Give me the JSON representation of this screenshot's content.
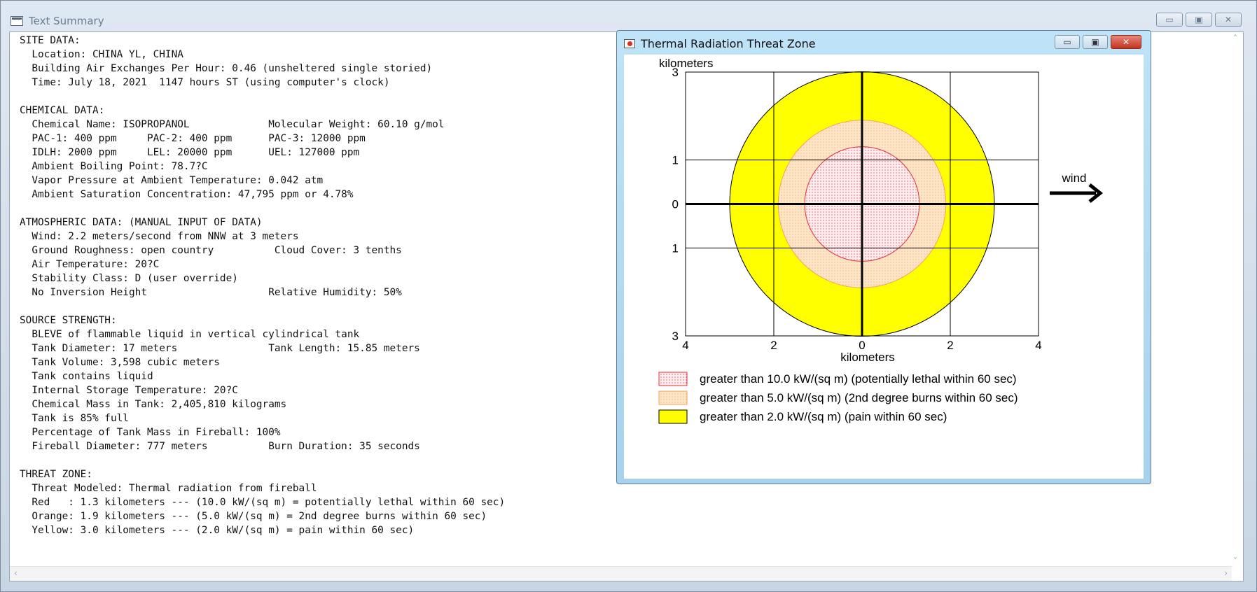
{
  "main_window": {
    "title": "Text Summary"
  },
  "summary_lines": [
    "SITE DATA:",
    "  Location: CHINA YL, CHINA",
    "  Building Air Exchanges Per Hour: 0.46 (unsheltered single storied)",
    "  Time: July 18, 2021  1147 hours ST (using computer's clock)",
    "",
    "CHEMICAL DATA:",
    "  Chemical Name: ISOPROPANOL             Molecular Weight: 60.10 g/mol",
    "  PAC-1: 400 ppm     PAC-2: 400 ppm      PAC-3: 12000 ppm",
    "  IDLH: 2000 ppm     LEL: 20000 ppm      UEL: 127000 ppm",
    "  Ambient Boiling Point: 78.7?C",
    "  Vapor Pressure at Ambient Temperature: 0.042 atm",
    "  Ambient Saturation Concentration: 47,795 ppm or 4.78%",
    "",
    "ATMOSPHERIC DATA: (MANUAL INPUT OF DATA)",
    "  Wind: 2.2 meters/second from NNW at 3 meters",
    "  Ground Roughness: open country          Cloud Cover: 3 tenths",
    "  Air Temperature: 20?C",
    "  Stability Class: D (user override)",
    "  No Inversion Height                    Relative Humidity: 50%",
    "",
    "SOURCE STRENGTH:",
    "  BLEVE of flammable liquid in vertical cylindrical tank",
    "  Tank Diameter: 17 meters               Tank Length: 15.85 meters",
    "  Tank Volume: 3,598 cubic meters",
    "  Tank contains liquid",
    "  Internal Storage Temperature: 20?C",
    "  Chemical Mass in Tank: 2,405,810 kilograms",
    "  Tank is 85% full",
    "  Percentage of Tank Mass in Fireball: 100%",
    "  Fireball Diameter: 777 meters          Burn Duration: 35 seconds",
    "",
    "THREAT ZONE:",
    "  Threat Modeled: Thermal radiation from fireball",
    "  Red   : 1.3 kilometers --- (10.0 kW/(sq m) = potentially lethal within 60 sec)",
    "  Orange: 1.9 kilometers --- (5.0 kW/(sq m) = 2nd degree burns within 60 sec)",
    "  Yellow: 3.0 kilometers --- (2.0 kW/(sq m) = pain within 60 sec)"
  ],
  "chart_window": {
    "title": "Thermal Radiation Threat Zone"
  },
  "chart_data": {
    "type": "threat_zone_map",
    "ylabel": "kilometers",
    "xlabel": "kilometers",
    "x_ticks": [
      "4",
      "2",
      "0",
      "2",
      "4"
    ],
    "y_ticks": [
      "3",
      "1",
      "0",
      "1",
      "3"
    ],
    "xlim": [
      -4,
      4
    ],
    "ylim": [
      -3,
      3
    ],
    "grid": true,
    "wind_label": "wind",
    "zones": [
      {
        "name": "Yellow",
        "radius_km": 3.0,
        "color": "#ffff00",
        "label": "greater than 2.0 kW/(sq m) (pain within 60 sec)"
      },
      {
        "name": "Orange",
        "radius_km": 1.9,
        "color": "#fde3c4",
        "label": "greater than 5.0 kW/(sq m) (2nd degree burns within 60 sec)"
      },
      {
        "name": "Red",
        "radius_km": 1.3,
        "color": "#fde8ea",
        "label": "greater than 10.0 kW/(sq m) (potentially lethal within 60 sec)"
      }
    ],
    "legend_order": [
      "Red",
      "Orange",
      "Yellow"
    ]
  }
}
